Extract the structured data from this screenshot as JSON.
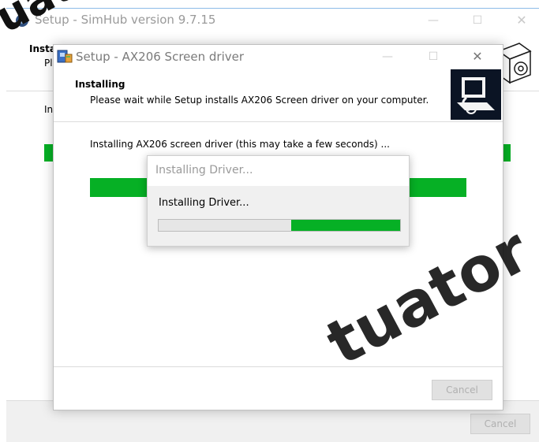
{
  "back_window": {
    "title": "Setup - SimHub version 9.7.15",
    "heading_fragment": "Insta",
    "sub_fragment": "Pl",
    "body_fragment": "In",
    "cancel_label": "Cancel"
  },
  "front_window": {
    "title": "Setup - AX206 Screen driver",
    "heading": "Installing",
    "subtitle": "Please wait while Setup installs AX206 Screen driver on your computer.",
    "status_text": "Installing AX206 screen driver (this may take a few seconds) ...",
    "progress": 1.0,
    "cancel_label": "Cancel"
  },
  "driver_dialog": {
    "title": "Installing Driver...",
    "message": "Installing Driver...",
    "progress_segment": {
      "start": 0.55,
      "end": 1.0
    }
  },
  "watermark": {
    "top_text": "uati",
    "bottom_text": "tuator"
  },
  "colors": {
    "accent": "#0078d7",
    "progress_green": "#06b025",
    "title_grey": "#9a9a9a"
  },
  "icons": {
    "app_icon": "simhub-icon",
    "setup_icon": "setup-box-icon",
    "hero_icon": "computer-install-icon",
    "disc_icon": "disc-box-icon"
  }
}
